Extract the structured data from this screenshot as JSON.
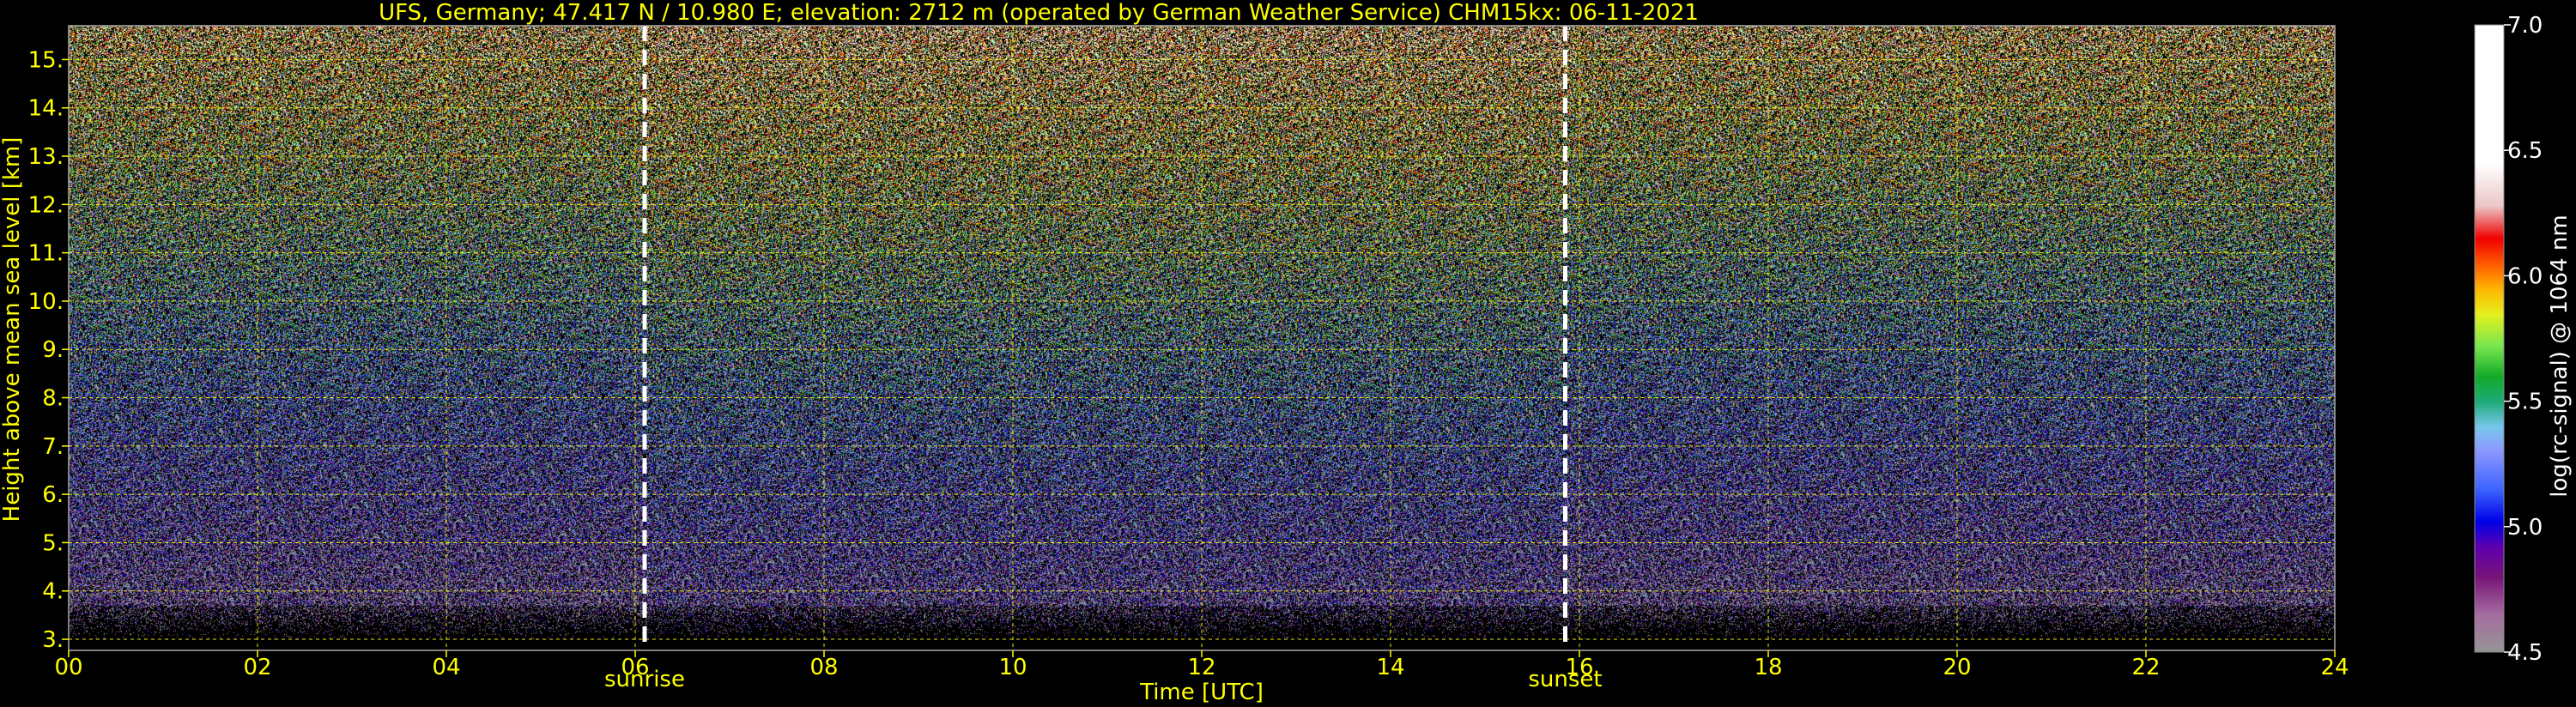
{
  "chart_data": {
    "type": "heatmap",
    "title": "UFS, Germany; 47.417 N / 10.980 E; elevation: 2712 m  (operated by German Weather Service)    CHM15kx: 06-11-2021",
    "xlabel": "Time [UTC]",
    "ylabel": "Height above mean sea level [km]",
    "xlim": [
      0,
      24
    ],
    "ylim": [
      2.77,
      15.7
    ],
    "x_ticks": [
      0,
      2,
      4,
      6,
      8,
      10,
      12,
      14,
      16,
      18,
      20,
      22,
      24
    ],
    "x_tick_labels": [
      "00",
      "02",
      "04",
      "06",
      "08",
      "10",
      "12",
      "14",
      "16",
      "18",
      "20",
      "22",
      "24"
    ],
    "y_ticks": [
      3,
      4,
      5,
      6,
      7,
      8,
      9,
      10,
      11,
      12,
      13,
      14,
      15
    ],
    "y_tick_labels": [
      "3.",
      "4.",
      "5.",
      "6.",
      "7.",
      "8.",
      "9.",
      "10.",
      "11.",
      "12.",
      "13.",
      "14.",
      "15."
    ],
    "grid": true,
    "markers": [
      {
        "label": "sunrise",
        "x": 6.1
      },
      {
        "label": "sunset",
        "x": 15.85
      }
    ],
    "colorbar": {
      "label": "log(rc-signal) @ 1064 nm",
      "range": [
        4.5,
        7.0
      ],
      "ticks": [
        4.5,
        5.0,
        5.5,
        6.0,
        6.5,
        7.0
      ],
      "tick_labels": [
        "4.5",
        "5.0",
        "5.5",
        "6.0",
        "6.5",
        "7.0"
      ]
    }
  },
  "colors": {
    "foreground": "#ffff00",
    "background": "#000000",
    "marker": "#ffffff"
  }
}
